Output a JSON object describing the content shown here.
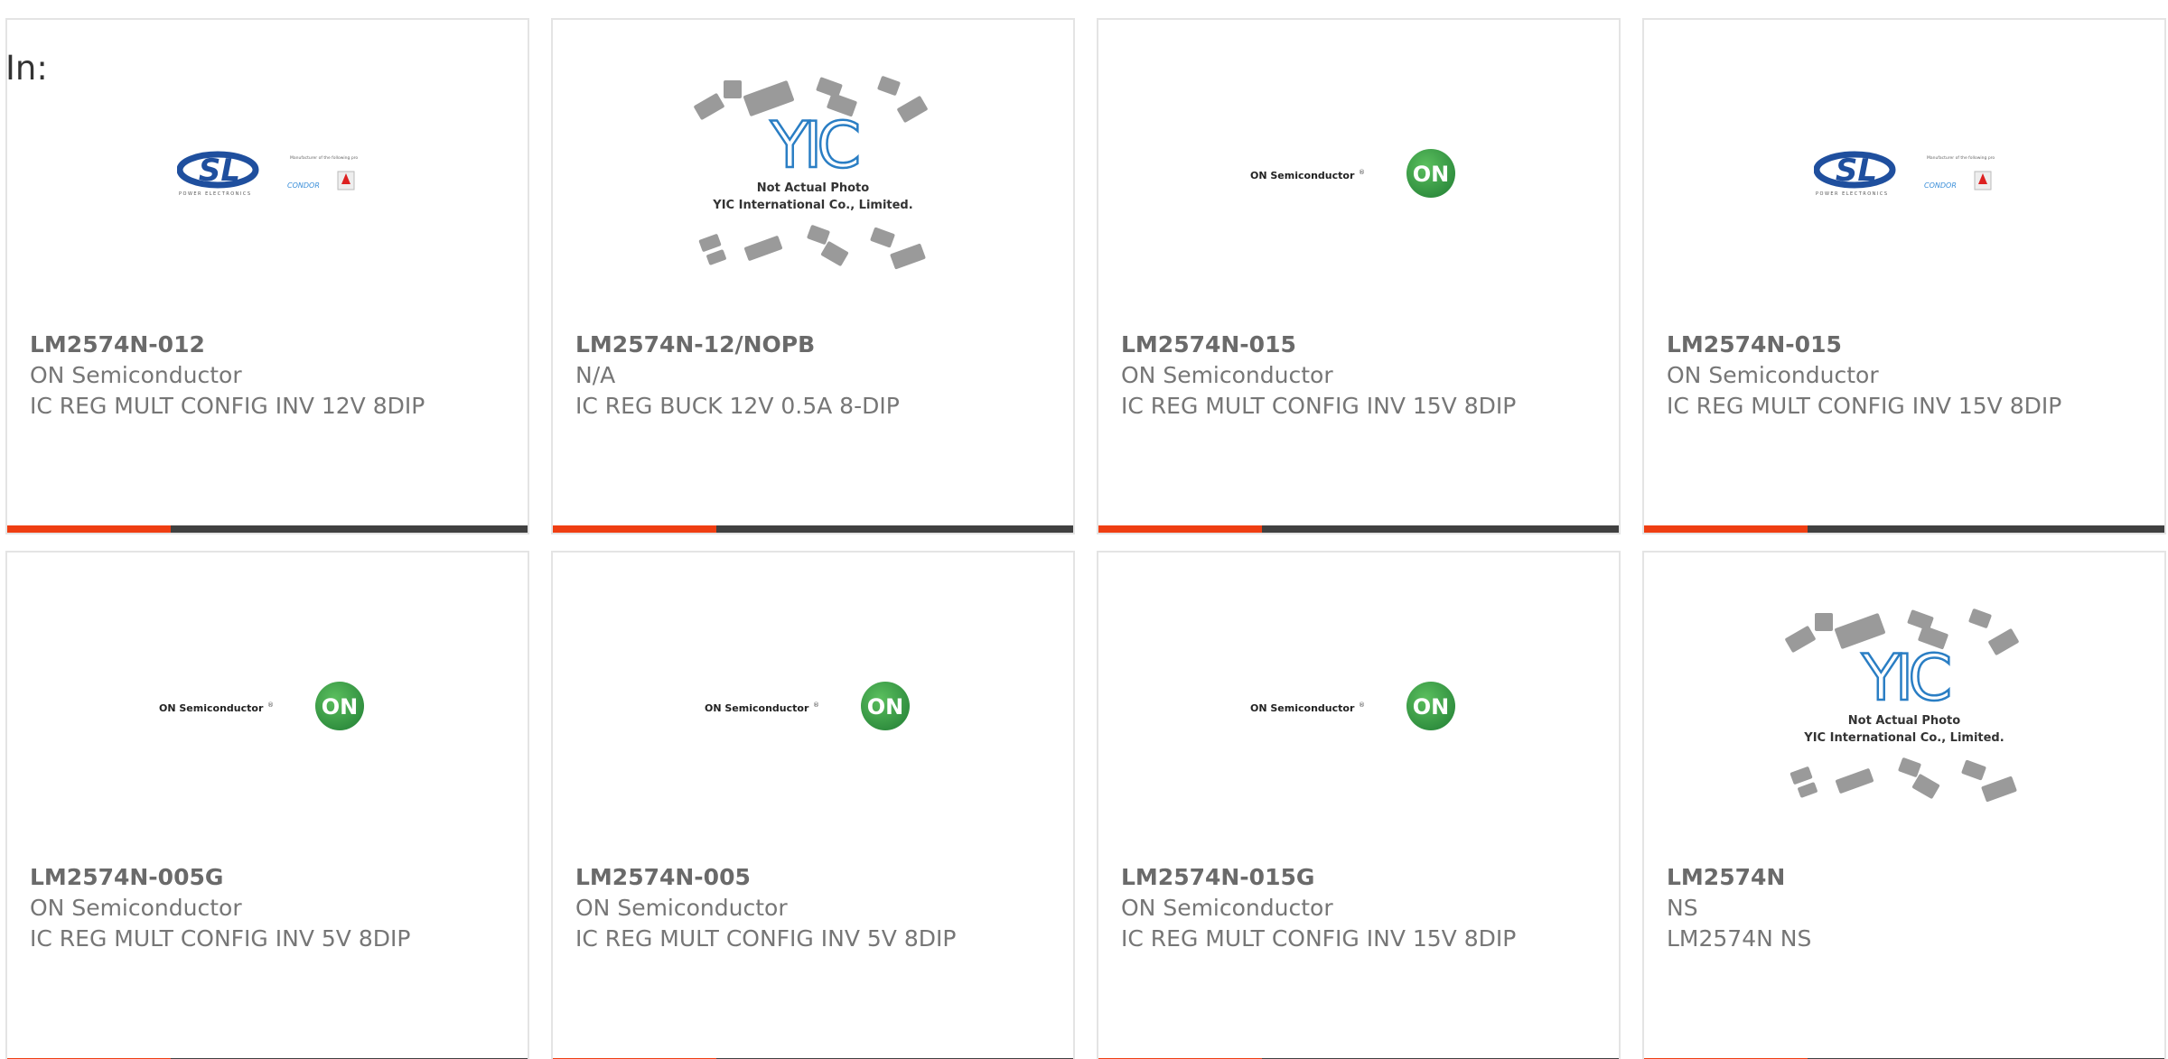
{
  "filter_label": "In:",
  "logos": {
    "on_text": "ON Semiconductor",
    "on_badge": "ON",
    "sl_text": "SL",
    "sl_sub": "POWER ELECTRONICS",
    "sl_condor": "CONDOR",
    "sl_note": "Manufacturer of the following product brands",
    "yic_text": "YIC",
    "yic_line1": "Not Actual Photo",
    "yic_line2": "YIC International Co., Limited."
  },
  "colors": {
    "accent": "#ef3e12",
    "bar_dark": "#404040",
    "on_green": "#2c8a3c",
    "sl_blue": "#1f4f9e",
    "yic_blue": "#2a7ec4"
  },
  "products": [
    {
      "part": "LM2574N-012",
      "manufacturer": "ON Semiconductor",
      "description": "IC REG MULT CONFIG INV 12V 8DIP",
      "logo": "sl-logo"
    },
    {
      "part": "LM2574N-12/NOPB",
      "manufacturer": "N/A",
      "description": "IC REG BUCK 12V 0.5A 8-DIP",
      "logo": "yic-placeholder"
    },
    {
      "part": "LM2574N-015",
      "manufacturer": "ON Semiconductor",
      "description": "IC REG MULT CONFIG INV 15V 8DIP",
      "logo": "on-semi-logo"
    },
    {
      "part": "LM2574N-015",
      "manufacturer": "ON Semiconductor",
      "description": "IC REG MULT CONFIG INV 15V 8DIP",
      "logo": "sl-logo"
    },
    {
      "part": "LM2574N-005G",
      "manufacturer": "ON Semiconductor",
      "description": "IC REG MULT CONFIG INV 5V 8DIP",
      "logo": "on-semi-logo"
    },
    {
      "part": "LM2574N-005",
      "manufacturer": "ON Semiconductor",
      "description": "IC REG MULT CONFIG INV 5V 8DIP",
      "logo": "on-semi-logo"
    },
    {
      "part": "LM2574N-015G",
      "manufacturer": "ON Semiconductor",
      "description": "IC REG MULT CONFIG INV 15V 8DIP",
      "logo": "on-semi-logo"
    },
    {
      "part": "LM2574N",
      "manufacturer": "NS",
      "description": "LM2574N NS",
      "logo": "yic-placeholder"
    }
  ]
}
